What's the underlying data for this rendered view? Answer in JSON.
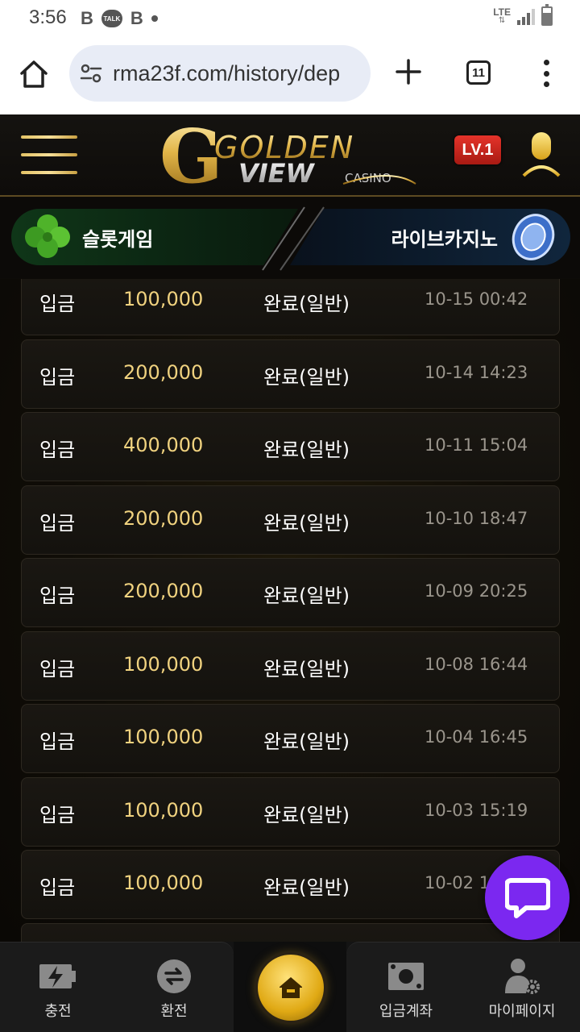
{
  "status_bar": {
    "time": "3:56",
    "icons": [
      "b-icon",
      "talk-icon",
      "b-icon",
      "dot-icon"
    ],
    "talk_label": "TALK",
    "network": "LTE"
  },
  "browser": {
    "url": "rma23f.com/history/dep",
    "tab_count": "11"
  },
  "header": {
    "logo_top": "GOLDEN",
    "logo_bottom": "VIEW",
    "logo_sub": "CASINO",
    "level": "LV.1"
  },
  "categories": {
    "slot_label": "슬롯게임",
    "live_label": "라이브카지노"
  },
  "history": [
    {
      "type": "입금",
      "amount": "100,000",
      "status": "완료(일반)",
      "date": "10-15 00:42"
    },
    {
      "type": "입금",
      "amount": "200,000",
      "status": "완료(일반)",
      "date": "10-14 14:23"
    },
    {
      "type": "입금",
      "amount": "400,000",
      "status": "완료(일반)",
      "date": "10-11 15:04"
    },
    {
      "type": "입금",
      "amount": "200,000",
      "status": "완료(일반)",
      "date": "10-10 18:47"
    },
    {
      "type": "입금",
      "amount": "200,000",
      "status": "완료(일반)",
      "date": "10-09 20:25"
    },
    {
      "type": "입금",
      "amount": "100,000",
      "status": "완료(일반)",
      "date": "10-08 16:44"
    },
    {
      "type": "입금",
      "amount": "100,000",
      "status": "완료(일반)",
      "date": "10-04 16:45"
    },
    {
      "type": "입금",
      "amount": "100,000",
      "status": "완료(일반)",
      "date": "10-03 15:19"
    },
    {
      "type": "입금",
      "amount": "100,000",
      "status": "완료(일반)",
      "date": "10-02 16"
    }
  ],
  "bottom_nav": {
    "charge": "충전",
    "exchange": "환전",
    "deposit_account": "입금계좌",
    "my_page": "마이페이지"
  },
  "colors": {
    "gold_accent": "#f0d27f",
    "chat_purple": "#7b28f0",
    "level_red": "#e5332a"
  }
}
